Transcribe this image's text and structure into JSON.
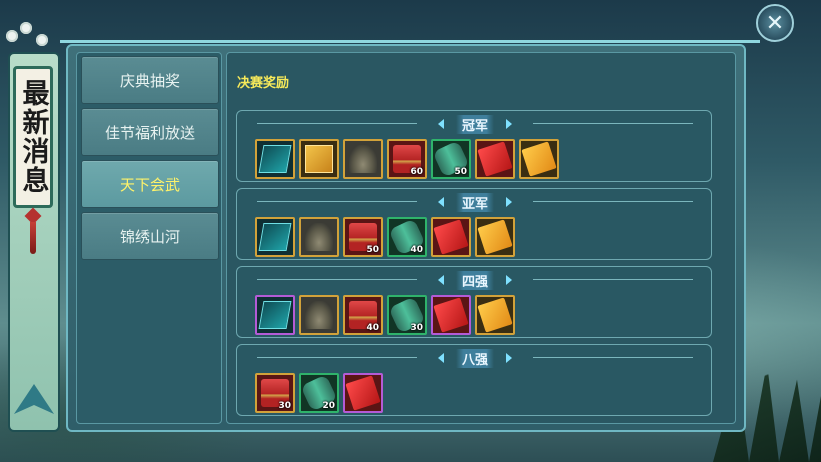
{
  "banner": {
    "title": "最新消息"
  },
  "close": {
    "icon": "close-icon",
    "glyph": "✕"
  },
  "tabs": [
    {
      "label": "庆典抽奖",
      "active": false
    },
    {
      "label": "佳节福利放送",
      "active": false
    },
    {
      "label": "天下会武",
      "active": true
    },
    {
      "label": "锦绣山河",
      "active": false
    }
  ],
  "content": {
    "title": "决赛奖励",
    "sections": [
      {
        "label": "冠军",
        "items": [
          {
            "icon": "skill-book-icon",
            "count": ""
          },
          {
            "icon": "gold-book-icon",
            "count": ""
          },
          {
            "icon": "statue-icon",
            "count": ""
          },
          {
            "icon": "red-chest-icon",
            "count": "60"
          },
          {
            "icon": "scroll-icon",
            "count": "50"
          },
          {
            "icon": "red-envelope-icon",
            "count": ""
          },
          {
            "icon": "gold-envelope-icon",
            "count": ""
          }
        ]
      },
      {
        "label": "亚军",
        "items": [
          {
            "icon": "skill-book-icon",
            "count": ""
          },
          {
            "icon": "statue-icon",
            "count": ""
          },
          {
            "icon": "red-chest-icon",
            "count": "50"
          },
          {
            "icon": "scroll-icon",
            "count": "40"
          },
          {
            "icon": "red-envelope-icon",
            "count": ""
          },
          {
            "icon": "gold-envelope-icon",
            "count": ""
          }
        ]
      },
      {
        "label": "四强",
        "items": [
          {
            "icon": "skill-book-icon",
            "count": ""
          },
          {
            "icon": "statue-icon",
            "count": ""
          },
          {
            "icon": "red-chest-icon",
            "count": "40"
          },
          {
            "icon": "scroll-icon",
            "count": "30"
          },
          {
            "icon": "red-envelope-icon",
            "count": ""
          },
          {
            "icon": "gold-envelope-icon",
            "count": ""
          }
        ]
      },
      {
        "label": "八强",
        "items": [
          {
            "icon": "red-chest-icon",
            "count": "30"
          },
          {
            "icon": "scroll-icon",
            "count": "20"
          },
          {
            "icon": "red-envelope-icon",
            "count": ""
          }
        ]
      }
    ]
  }
}
